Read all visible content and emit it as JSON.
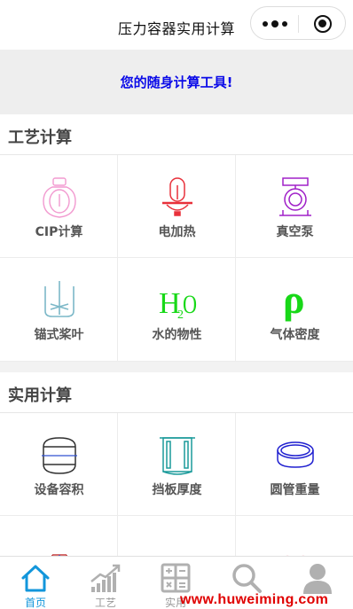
{
  "navbar": {
    "title": "压力容器实用计算"
  },
  "banner": {
    "text": "您的随身计算工具!"
  },
  "sections": [
    {
      "title": "工艺计算",
      "items": [
        {
          "label": "CIP计算",
          "icon": "cip-tank-icon",
          "color": "#f29ad0"
        },
        {
          "label": "电加热",
          "icon": "electric-heater-icon",
          "color": "#e8303a"
        },
        {
          "label": "真空泵",
          "icon": "vacuum-pump-icon",
          "color": "#a020c8"
        },
        {
          "label": "锚式桨叶",
          "icon": "anchor-impeller-icon",
          "color": "#7cb8c8"
        },
        {
          "label": "水的物性",
          "icon": "h2o-icon",
          "icon_text": "H₂O",
          "color": "#18d818"
        },
        {
          "label": "气体密度",
          "icon": "rho-icon",
          "icon_text": "ρ",
          "color": "#18d818"
        }
      ]
    },
    {
      "title": "实用计算",
      "items": [
        {
          "label": "设备容积",
          "icon": "vessel-volume-icon",
          "color": "#303030"
        },
        {
          "label": "挡板厚度",
          "icon": "baffle-tank-icon",
          "color": "#1a9a9a"
        },
        {
          "label": "圆管重量",
          "icon": "pipe-ring-icon",
          "color": "#2020d0"
        },
        {
          "label": "",
          "icon": "cone-icon",
          "color": "#c03030"
        },
        {
          "label": "",
          "icon": "dish-head-icon",
          "color": "#a080c0"
        },
        {
          "label": "",
          "icon": "heart-icon",
          "color": "#d02040"
        }
      ]
    }
  ],
  "tabbar": {
    "items": [
      {
        "label": "首页",
        "icon": "home-icon",
        "active": true
      },
      {
        "label": "工艺",
        "icon": "bar-chart-icon",
        "active": false
      },
      {
        "label": "实用",
        "icon": "calculator-icon",
        "active": false
      },
      {
        "label": "",
        "icon": "search-icon",
        "active": false
      },
      {
        "label": "",
        "icon": "user-icon",
        "active": false
      }
    ]
  },
  "colors": {
    "accent": "#1296db",
    "banner_text": "#0a0ae8",
    "watermark": "#e00000"
  },
  "watermark": {
    "text": "www.huweiming.com"
  }
}
